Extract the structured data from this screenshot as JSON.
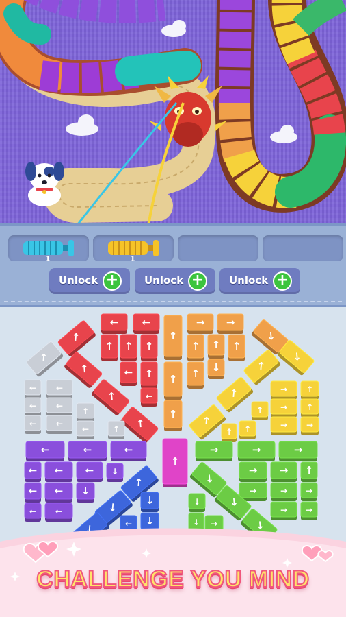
{
  "colors": {
    "purple_bg": "#7c62d8",
    "slot_bg": "#7e93c4",
    "unlock_bg": "#6f7cc0",
    "plus_green": "#3cc43e",
    "tagline_fill": "#ffe46a",
    "tagline_outline": "#f0567c",
    "banner_pink": "#fbd3e0"
  },
  "scene": {
    "characters": [
      "dragon",
      "puppy"
    ],
    "icons": [
      "cloud-icon",
      "heart-icon",
      "sparkle-icon"
    ]
  },
  "slots": [
    {
      "spool_color": "#39c6e6",
      "count": "1"
    },
    {
      "spool_color": "#f6c328",
      "count": "1"
    },
    {
      "spool_color": "",
      "count": ""
    },
    {
      "spool_color": "",
      "count": ""
    }
  ],
  "unlock_buttons": [
    {
      "label": "Unlock",
      "icon": "plus-icon"
    },
    {
      "label": "Unlock",
      "icon": "plus-icon"
    },
    {
      "label": "Unlock",
      "icon": "plus-icon"
    }
  ],
  "board": {
    "block_colors": {
      "red": "#e8444c",
      "orange": "#f0a04a",
      "yellow": "#f6d23a",
      "green": "#6ccc45",
      "gray": "#c9ced6",
      "purple": "#8a4fdc",
      "blue": "#3d66dc",
      "magenta": "#e044c8"
    }
  },
  "banner": {
    "tagline": "CHALLENGE YOU MIND"
  }
}
